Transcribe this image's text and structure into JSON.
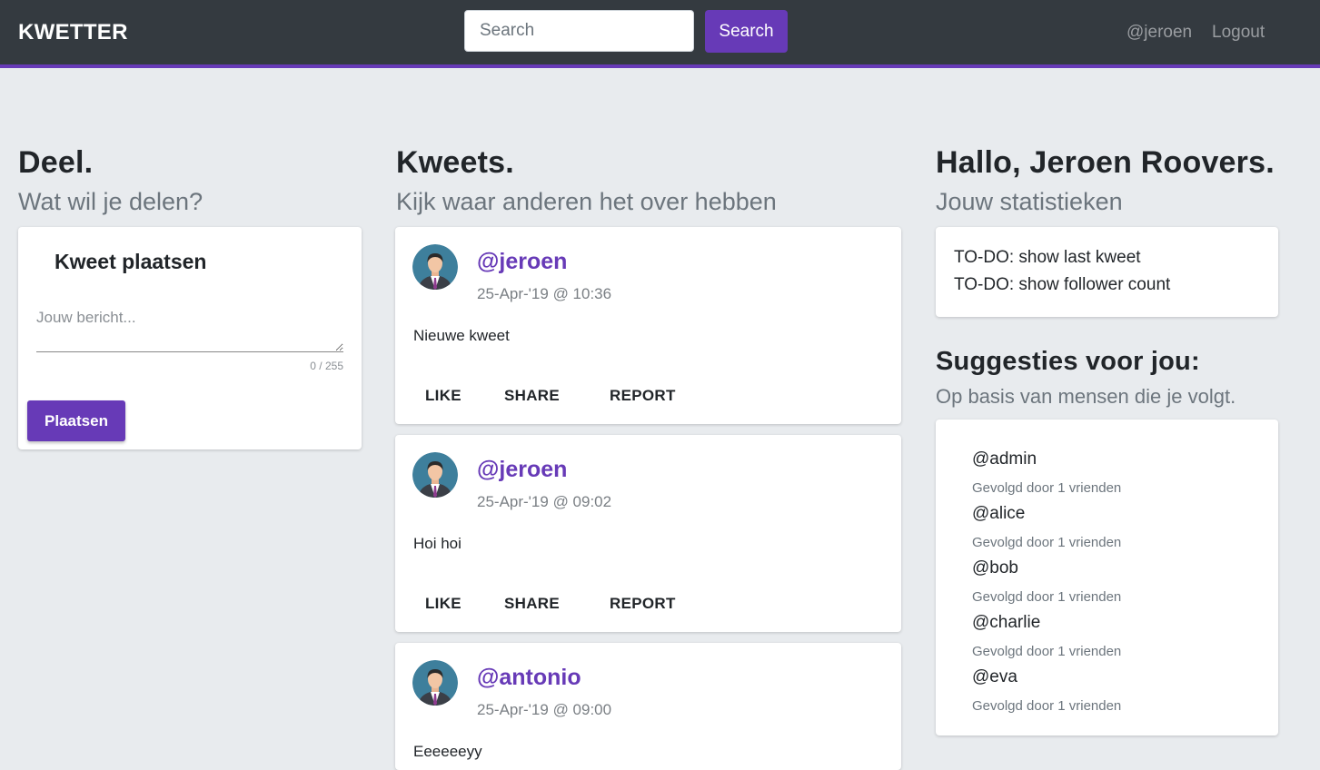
{
  "navbar": {
    "brand": "KWETTER",
    "search_placeholder": "Search",
    "search_button": "Search",
    "user_link": "@jeroen",
    "logout_link": "Logout",
    "accent_color": "#673ab7"
  },
  "share_section": {
    "title": "Deel.",
    "subtitle": "Wat wil je delen?",
    "composer_title": "Kweet plaatsen",
    "message_placeholder": "Jouw bericht...",
    "counter": "0 / 255",
    "post_button": "Plaatsen"
  },
  "kweets_section": {
    "title": "Kweets.",
    "subtitle": "Kijk waar anderen het over hebben",
    "actions": {
      "like": "LIKE",
      "share": "SHARE",
      "report": "REPORT"
    },
    "kweets": [
      {
        "user": "@jeroen",
        "time": "25-Apr-'19 @ 10:36",
        "text": "Nieuwe kweet"
      },
      {
        "user": "@jeroen",
        "time": "25-Apr-'19 @ 09:02",
        "text": "Hoi hoi"
      },
      {
        "user": "@antonio",
        "time": "25-Apr-'19 @ 09:00",
        "text": "Eeeeeeyy"
      }
    ]
  },
  "profile_section": {
    "greeting": "Hallo, Jeroen Roovers.",
    "subtitle": "Jouw statistieken",
    "stats": [
      "TO-DO: show last kweet",
      "TO-DO: show follower count"
    ]
  },
  "suggestions_section": {
    "title": "Suggesties voor jou:",
    "subtitle": "Op basis van mensen die je volgt.",
    "items": [
      {
        "name": "@admin",
        "meta": "Gevolgd door 1 vrienden"
      },
      {
        "name": "@alice",
        "meta": "Gevolgd door 1 vrienden"
      },
      {
        "name": "@bob",
        "meta": "Gevolgd door 1 vrienden"
      },
      {
        "name": "@charlie",
        "meta": "Gevolgd door 1 vrienden"
      },
      {
        "name": "@eva",
        "meta": "Gevolgd door 1 vrienden"
      }
    ]
  }
}
